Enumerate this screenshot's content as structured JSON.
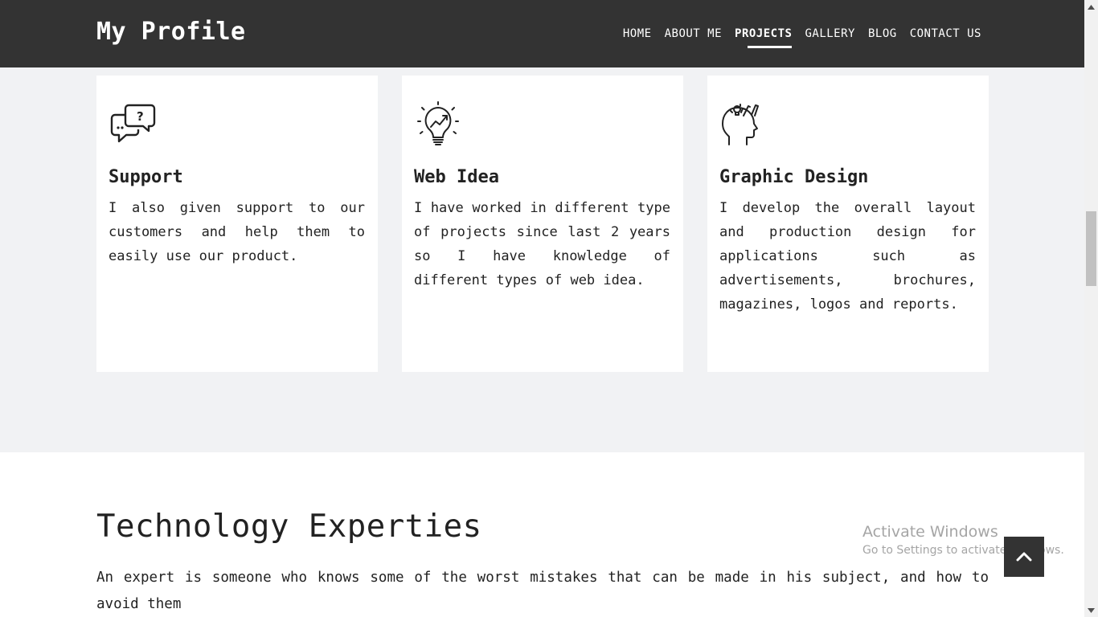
{
  "header": {
    "brand": "My Profile",
    "nav": [
      {
        "label": "HOME",
        "active": false
      },
      {
        "label": "ABOUT ME",
        "active": false
      },
      {
        "label": "PROJECTS",
        "active": true
      },
      {
        "label": "GALLERY",
        "active": false
      },
      {
        "label": "BLOG",
        "active": false
      },
      {
        "label": "CONTACT US",
        "active": false
      }
    ]
  },
  "services": [
    {
      "icon": "chat-question-icon",
      "title": "Support",
      "text": "I also given support to our customers and help them to easily use our product."
    },
    {
      "icon": "lightbulb-growth-icon",
      "title": "Web Idea",
      "text": "I have worked in different type of projects since last 2 years so I have knowledge of different types of web idea."
    },
    {
      "icon": "head-creative-icon",
      "title": "Graphic Design",
      "text": "I develop the overall layout and production design for applications such as advertisements, brochures, magazines, logos and reports."
    }
  ],
  "tech": {
    "title": "Technology Experties",
    "text": "An expert is someone who knows some of the worst mistakes that can be made in his subject, and how to avoid them"
  },
  "watermark": {
    "title": "Activate Windows",
    "subtitle": "Go to Settings to activate Windows."
  },
  "colors": {
    "header_bg": "#333333",
    "section_bg": "#f1f2f4",
    "card_bg": "#ffffff",
    "text": "#222222"
  }
}
